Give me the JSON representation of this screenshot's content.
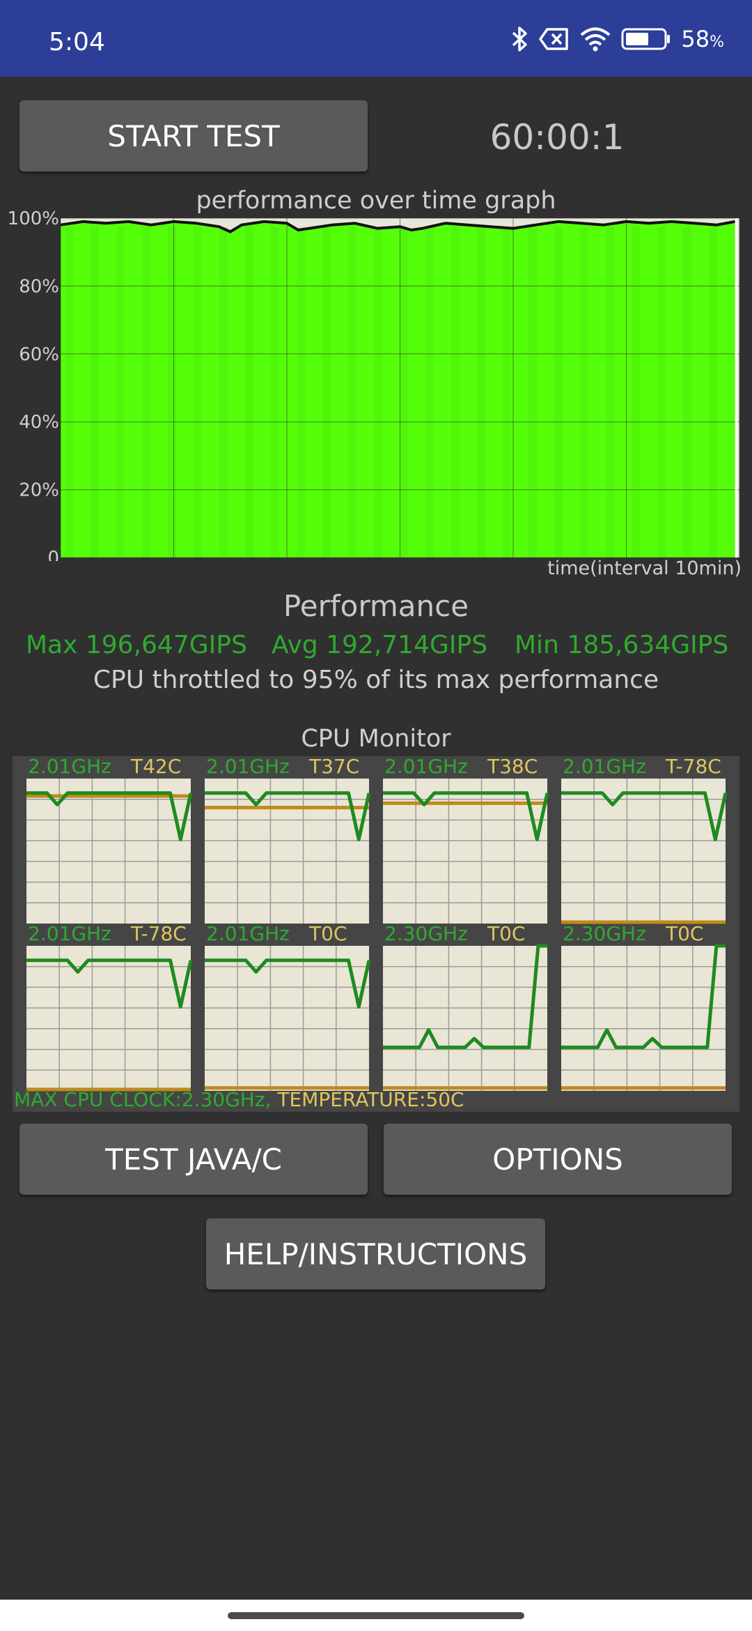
{
  "status_bar": {
    "time": "5:04",
    "battery_percent": "58",
    "battery_symbol": "%",
    "icons": [
      "bluetooth-icon",
      "no-sim-icon",
      "wifi-icon",
      "battery-icon"
    ]
  },
  "controls": {
    "start_test_label": "START TEST",
    "timer": "60:00:1",
    "test_java_label": "TEST JAVA/C",
    "options_label": "OPTIONS",
    "help_label": "HELP/INSTRUCTIONS"
  },
  "graph": {
    "title": "performance over time graph",
    "xlabel": "time(interval 10min)",
    "y_ticks": [
      "100%",
      "80%",
      "60%",
      "40%",
      "20%",
      "0"
    ],
    "colors": {
      "fill": "#55ff0a",
      "background": "#e9e6d6",
      "line": "#111111",
      "grid": "#333333"
    }
  },
  "chart_data": {
    "type": "area",
    "title": "performance over time graph",
    "xlabel": "time(interval 10min)",
    "ylabel": "",
    "ylim": [
      0,
      100
    ],
    "y_ticks": [
      0,
      20,
      40,
      60,
      80,
      100
    ],
    "x_interval_minutes": 10,
    "x_range_minutes": [
      0,
      60
    ],
    "grid": true,
    "series": [
      {
        "x_minutes": [
          0,
          2,
          4,
          6,
          8,
          10,
          12,
          14,
          15,
          16,
          18,
          20,
          21,
          22,
          24,
          26,
          28,
          30,
          31,
          32,
          34,
          36,
          38,
          40,
          42,
          44,
          46,
          48,
          50,
          52,
          54,
          56,
          58,
          59.6
        ],
        "values": [
          98,
          99,
          98.5,
          99,
          98,
          99,
          98.5,
          97.5,
          96,
          98,
          99,
          98.5,
          96.5,
          97,
          98,
          98.5,
          97,
          97.5,
          96.5,
          97,
          98.5,
          98,
          97.5,
          97,
          98,
          99,
          98.5,
          98,
          99,
          98.5,
          99,
          98.5,
          98,
          99
        ]
      }
    ]
  },
  "performance": {
    "title": "Performance",
    "max": "Max 196,647GIPS",
    "avg": "Avg 192,714GIPS",
    "min": "Min 185,634GIPS",
    "throttle": "CPU throttled to 95% of its max performance"
  },
  "cpu_monitor": {
    "title": "CPU Monitor",
    "footer_clock": "MAX CPU CLOCK:2.30GHz,",
    "footer_temp": "TEMPERATURE:50C",
    "cores": [
      {
        "freq": "2.01GHz",
        "temp": "T42C",
        "freq_level": [
          0.9,
          0.9,
          0.9,
          0.82,
          0.9,
          0.9,
          0.9,
          0.9,
          0.9,
          0.9,
          0.9,
          0.9,
          0.9,
          0.9,
          0.9,
          0.58,
          0.9
        ],
        "temp_level": 0.88
      },
      {
        "freq": "2.01GHz",
        "temp": "T37C",
        "freq_level": [
          0.9,
          0.9,
          0.9,
          0.9,
          0.9,
          0.82,
          0.9,
          0.9,
          0.9,
          0.9,
          0.9,
          0.9,
          0.9,
          0.9,
          0.9,
          0.58,
          0.9
        ],
        "temp_level": 0.8
      },
      {
        "freq": "2.01GHz",
        "temp": "T38C",
        "freq_level": [
          0.9,
          0.9,
          0.9,
          0.9,
          0.82,
          0.9,
          0.9,
          0.9,
          0.9,
          0.9,
          0.9,
          0.9,
          0.9,
          0.9,
          0.9,
          0.58,
          0.9
        ],
        "temp_level": 0.83
      },
      {
        "freq": "2.01GHz",
        "temp": "T-78C",
        "freq_level": [
          0.9,
          0.9,
          0.9,
          0.9,
          0.9,
          0.82,
          0.9,
          0.9,
          0.9,
          0.9,
          0.9,
          0.9,
          0.9,
          0.9,
          0.9,
          0.58,
          0.9
        ],
        "temp_level": 0
      },
      {
        "freq": "2.01GHz",
        "temp": "T-78C",
        "freq_level": [
          0.9,
          0.9,
          0.9,
          0.9,
          0.9,
          0.82,
          0.9,
          0.9,
          0.9,
          0.9,
          0.9,
          0.9,
          0.9,
          0.9,
          0.9,
          0.58,
          0.9
        ],
        "temp_level": 0
      },
      {
        "freq": "2.01GHz",
        "temp": "T0C",
        "freq_level": [
          0.9,
          0.9,
          0.9,
          0.9,
          0.9,
          0.82,
          0.9,
          0.9,
          0.9,
          0.9,
          0.9,
          0.9,
          0.9,
          0.9,
          0.9,
          0.58,
          0.9
        ],
        "temp_level": 0.02
      },
      {
        "freq": "2.30GHz",
        "temp": "T0C",
        "freq_level": [
          0.3,
          0.3,
          0.3,
          0.3,
          0.3,
          0.42,
          0.3,
          0.3,
          0.3,
          0.3,
          0.36,
          0.3,
          0.3,
          0.3,
          0.3,
          0.3,
          0.3,
          1.0,
          1.0
        ],
        "temp_level": 0.02
      },
      {
        "freq": "2.30GHz",
        "temp": "T0C",
        "freq_level": [
          0.3,
          0.3,
          0.3,
          0.3,
          0.3,
          0.42,
          0.3,
          0.3,
          0.3,
          0.3,
          0.36,
          0.3,
          0.3,
          0.3,
          0.3,
          0.3,
          0.3,
          1.0,
          1.0
        ],
        "temp_level": 0.02
      }
    ]
  }
}
